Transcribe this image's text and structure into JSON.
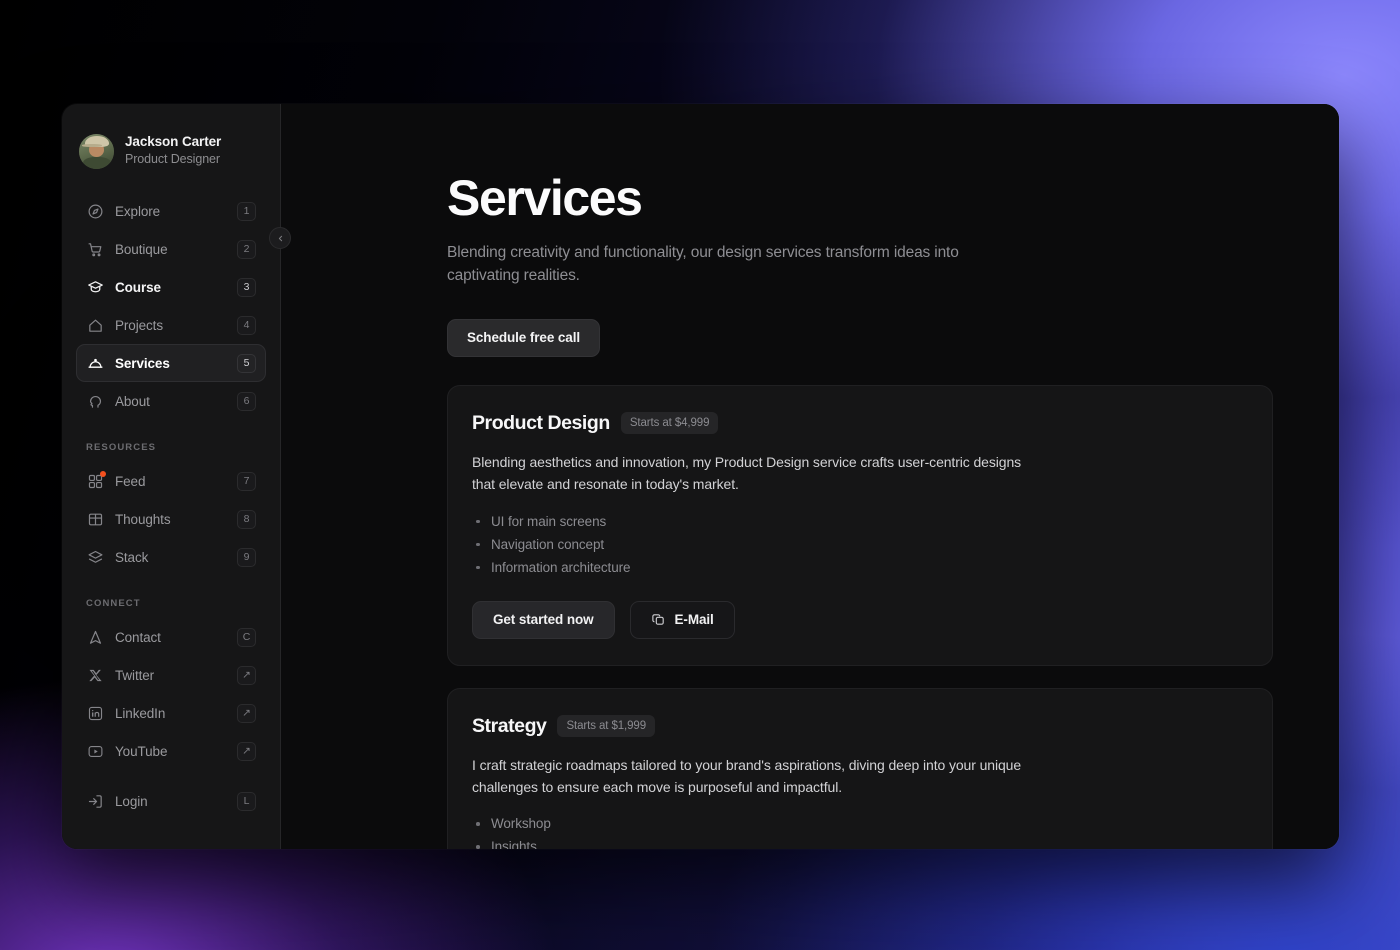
{
  "profile": {
    "name": "Jackson Carter",
    "role": "Product Designer",
    "avatar_icon": "avatar-photo",
    "collapse_icon": "chevron-left-icon"
  },
  "sidebar": {
    "primary_items": [
      {
        "label": "Explore",
        "shortcut": "1",
        "icon": "compass-icon",
        "state": "default"
      },
      {
        "label": "Boutique",
        "shortcut": "2",
        "icon": "cart-icon",
        "state": "default"
      },
      {
        "label": "Course",
        "shortcut": "3",
        "icon": "graduation-cap-icon",
        "state": "strong"
      },
      {
        "label": "Projects",
        "shortcut": "4",
        "icon": "home-icon",
        "state": "default"
      },
      {
        "label": "Services",
        "shortcut": "5",
        "icon": "cloche-icon",
        "state": "active"
      },
      {
        "label": "About",
        "shortcut": "6",
        "icon": "speech-head-icon",
        "state": "default"
      }
    ],
    "resources_label": "RESOURCES",
    "resources_items": [
      {
        "label": "Feed",
        "shortcut": "7",
        "icon": "layout-grid-icon",
        "badge": true
      },
      {
        "label": "Thoughts",
        "shortcut": "8",
        "icon": "open-book-icon",
        "badge": false
      },
      {
        "label": "Stack",
        "shortcut": "9",
        "icon": "layers-icon",
        "badge": false
      }
    ],
    "connect_label": "CONNECT",
    "connect_items": [
      {
        "label": "Contact",
        "shortcut": "C",
        "icon": "send-icon",
        "shortcut_icon": false
      },
      {
        "label": "Twitter",
        "shortcut": "↗",
        "icon": "x-twitter-icon",
        "shortcut_icon": true
      },
      {
        "label": "LinkedIn",
        "shortcut": "↗",
        "icon": "linkedin-icon",
        "shortcut_icon": true
      },
      {
        "label": "YouTube",
        "shortcut": "↗",
        "icon": "youtube-icon",
        "shortcut_icon": true
      }
    ],
    "login_item": {
      "label": "Login",
      "shortcut": "L",
      "icon": "login-arrow-icon"
    }
  },
  "main": {
    "title": "Services",
    "subtitle": "Blending creativity and functionality, our design services transform ideas into captivating realities.",
    "cta_label": "Schedule free call",
    "cards": [
      {
        "title": "Product Design",
        "price": "Starts at $4,999",
        "description": "Blending aesthetics and innovation, my Product Design service crafts user-centric designs that elevate and resonate in today's market.",
        "features": [
          "UI for main screens",
          "Navigation concept",
          "Information architecture"
        ],
        "primary_label": "Get started now",
        "secondary_label": "E-Mail",
        "secondary_icon": "copy-icon"
      },
      {
        "title": "Strategy",
        "price": "Starts at $1,999",
        "description": "I craft strategic roadmaps tailored to your brand's aspirations, diving deep into your unique challenges to ensure each move is purposeful and impactful.",
        "features": [
          "Workshop",
          "Insights"
        ]
      }
    ]
  },
  "colors": {
    "accent_badge": "#f4501e",
    "backdrop_violet": "#7c7cf5",
    "backdrop_purple": "#7a38cd",
    "backdrop_blue": "#2e42c8",
    "window_bg": "#0b0b0c",
    "sidebar_bg": "#161617",
    "card_bg": "#151516"
  }
}
